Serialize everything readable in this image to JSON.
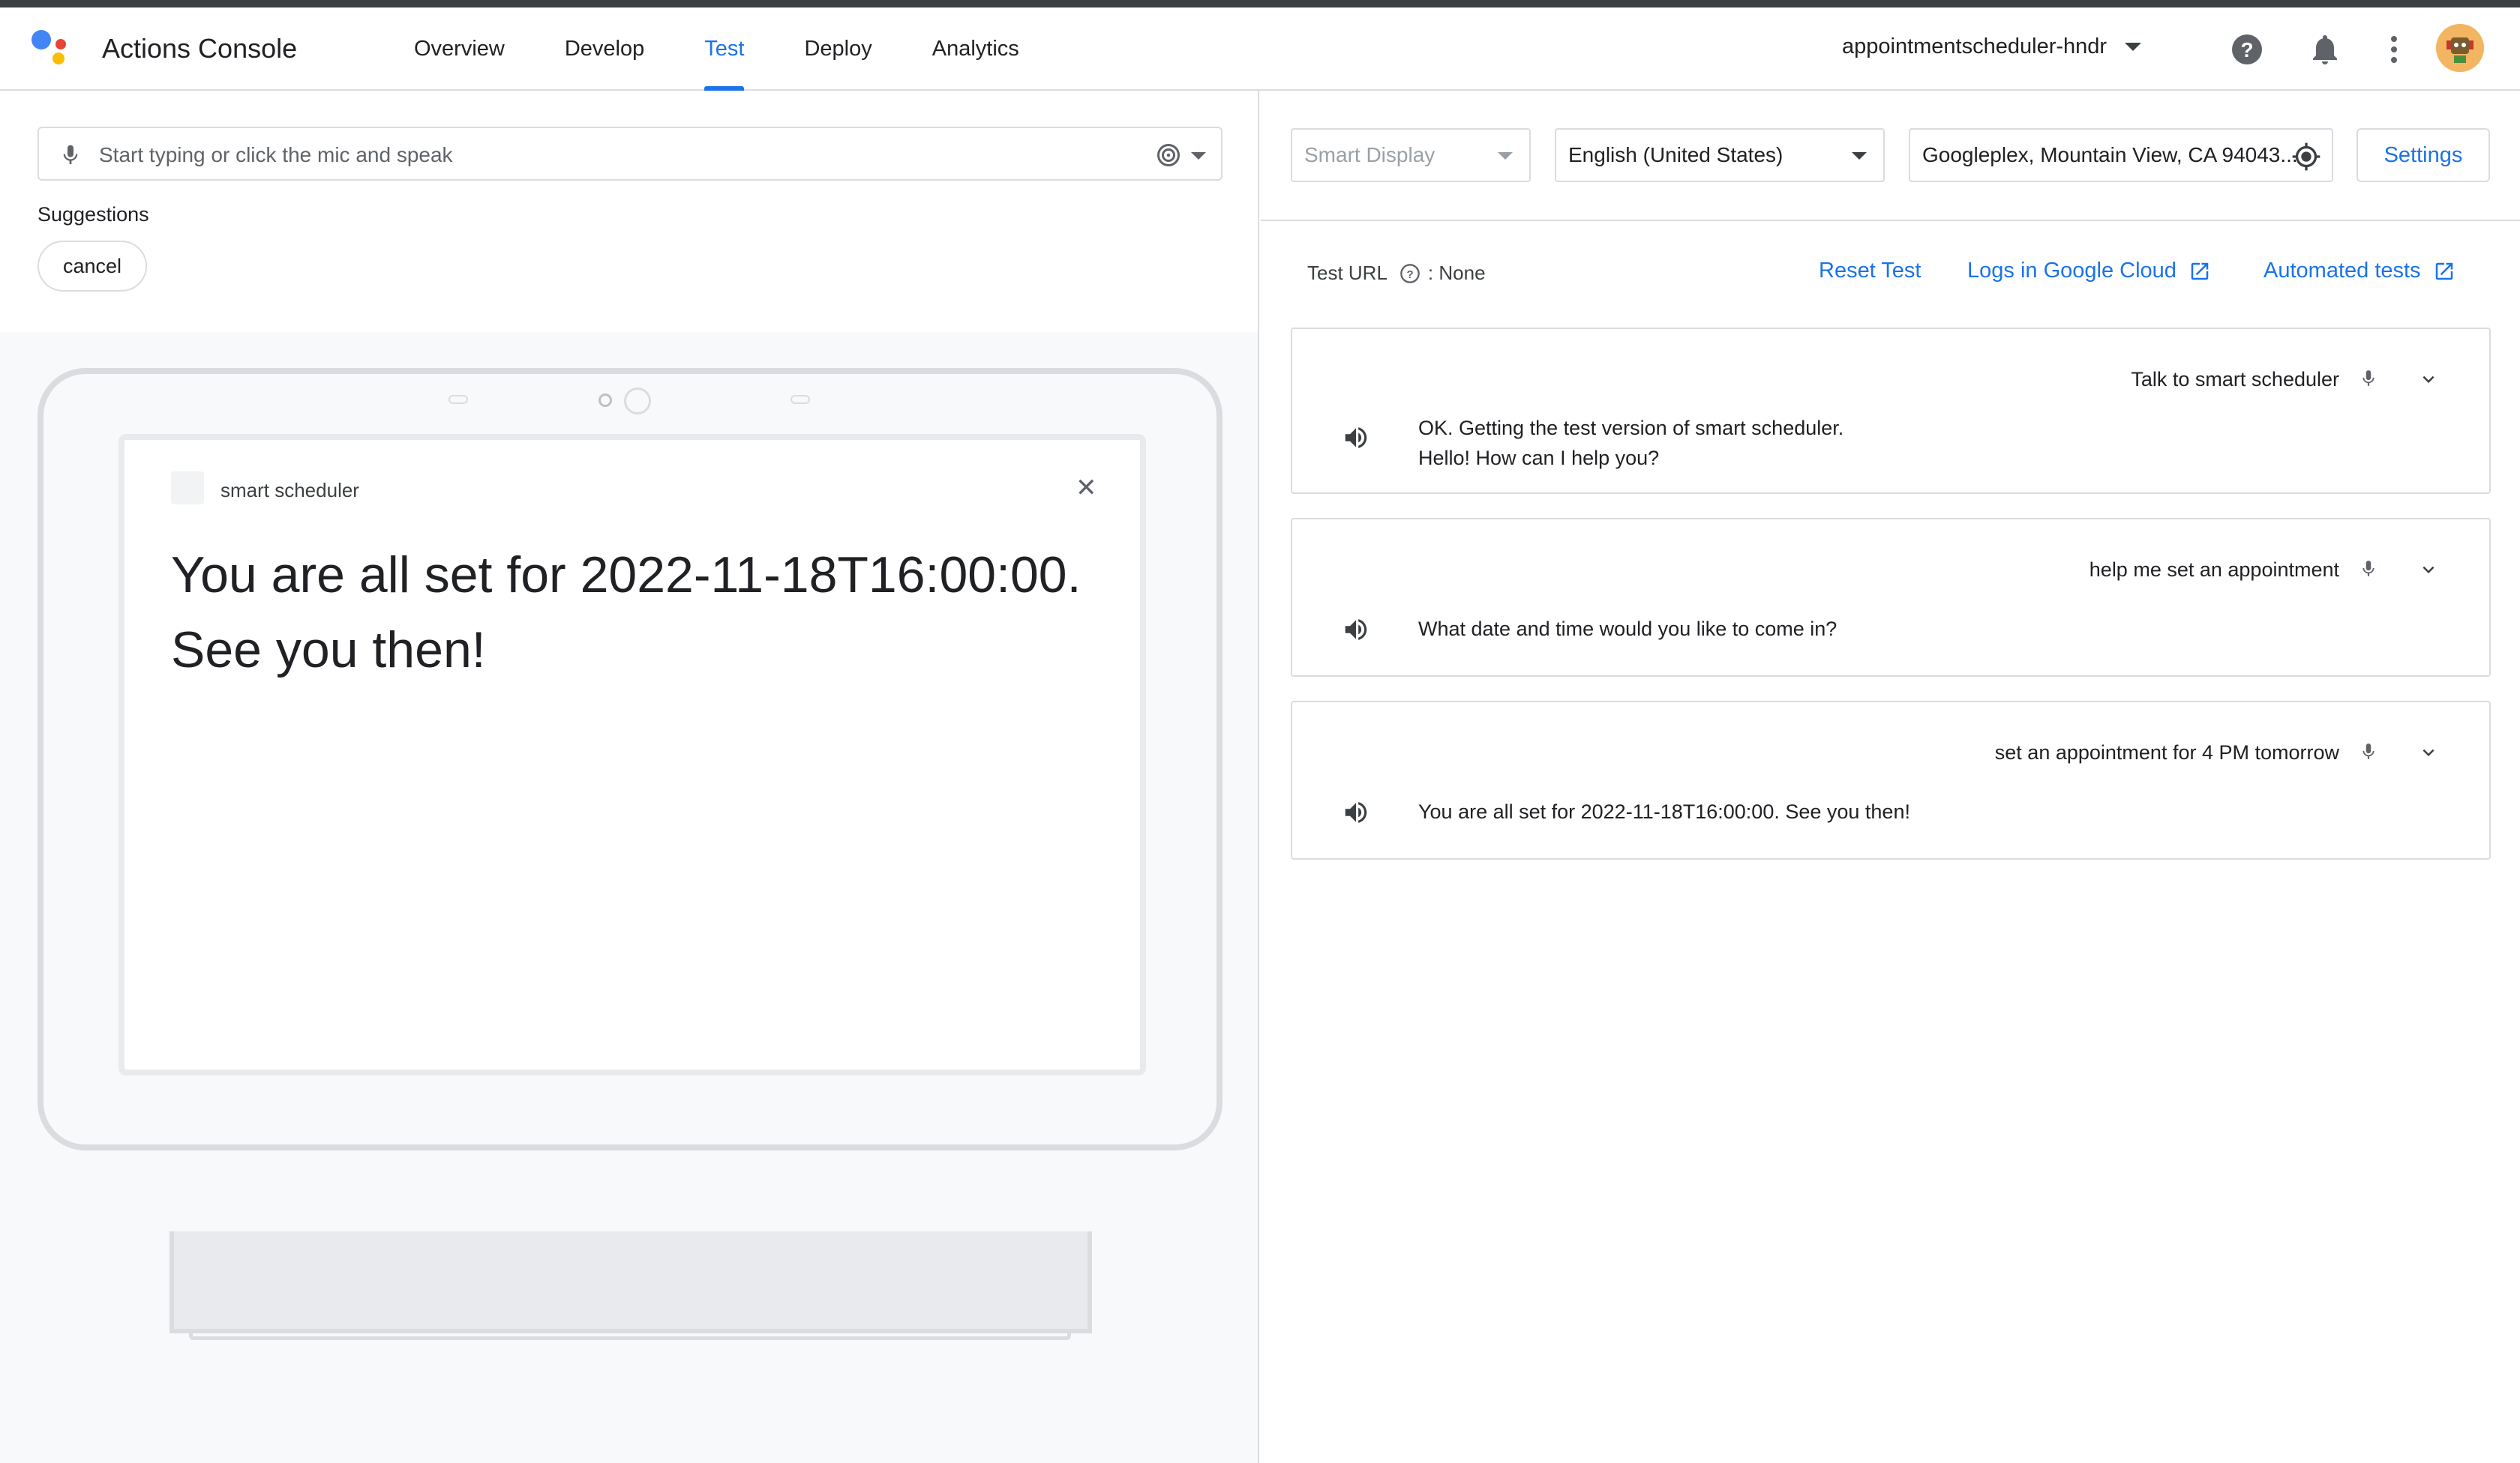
{
  "app": {
    "title": "Actions Console"
  },
  "nav": {
    "tabs": [
      {
        "label": "Overview"
      },
      {
        "label": "Develop"
      },
      {
        "label": "Test",
        "active": true
      },
      {
        "label": "Deploy"
      },
      {
        "label": "Analytics"
      }
    ]
  },
  "header": {
    "project": "appointmentscheduler-hndr"
  },
  "query": {
    "placeholder": "Start typing or click the mic and speak"
  },
  "suggestions": {
    "label": "Suggestions",
    "chips": [
      "cancel"
    ]
  },
  "display": {
    "app_name": "smart scheduler",
    "message": "You are all set for 2022-11-18T16:00:00. See you then!"
  },
  "controls": {
    "surface": "Smart Display",
    "language": "English (United States)",
    "location": "Googleplex, Mountain View, CA 94043...",
    "settings": "Settings"
  },
  "test": {
    "url_label": "Test URL",
    "url_value": ": None",
    "reset": "Reset Test",
    "logs": "Logs in Google Cloud",
    "automated": "Automated tests"
  },
  "conversation": [
    {
      "user": "Talk to smart scheduler",
      "response_line1": "OK. Getting the test version of smart scheduler.",
      "response_line2": "Hello! How can I help you?"
    },
    {
      "user": "help me set an appointment",
      "response_line1": "What date and time would you like to come in?"
    },
    {
      "user": "set an appointment for 4 PM tomorrow",
      "response_line1": "You are all set for 2022-11-18T16:00:00. See you then!"
    }
  ],
  "colors": {
    "accent": "#1a73e8",
    "border": "#dadce0",
    "text": "#202124"
  },
  "icons": [
    "mic-icon",
    "assistant-icon",
    "help-icon",
    "notifications-icon",
    "more-vert-icon",
    "gps-icon",
    "external-link-icon",
    "volume-icon",
    "chevron-down-icon",
    "close-icon"
  ]
}
